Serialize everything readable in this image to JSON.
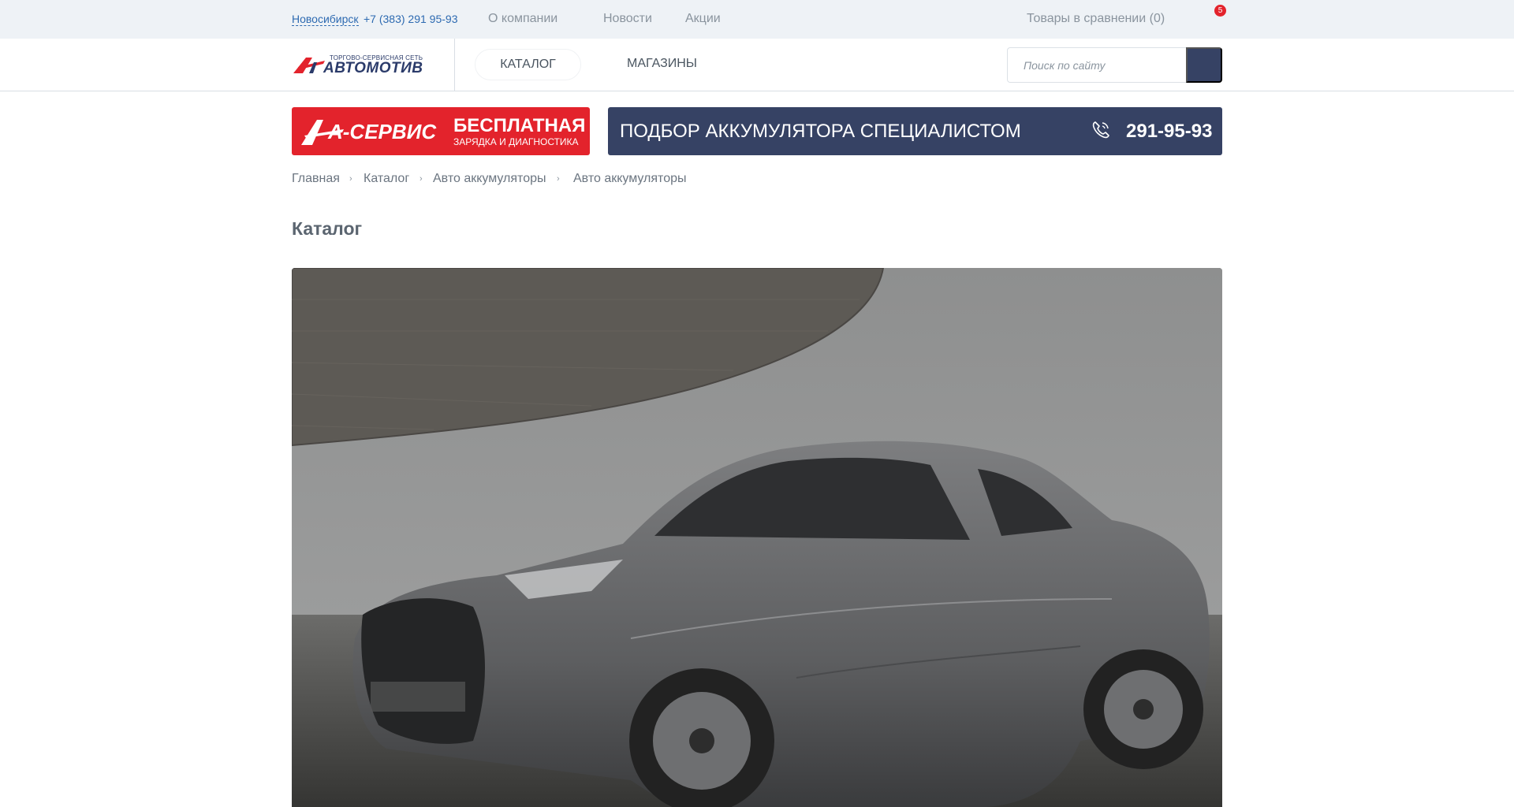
{
  "topbar": {
    "city": "Новосибирск",
    "phone": "+7 (383) 291 95-93",
    "nav": [
      "О компании",
      "Новости",
      "Акции"
    ],
    "compare": "Товары в сравнении (0)",
    "cart_count": "5"
  },
  "header": {
    "logo_tagline": "ТОРГОВО-СЕРВИСНАЯ СЕТЬ",
    "logo_brand": "АВТОМОТИВ",
    "menu_catalog": "КАТАЛОГ",
    "menu_shops": "МАГАЗИНЫ",
    "search_placeholder": "Поиск по сайту"
  },
  "banner_service": {
    "brand": "А-СЕРВИС",
    "headline": "БЕСПЛАТНАЯ",
    "subline": "ЗАРЯДКА И ДИАГНОСТИКА"
  },
  "banner_battery": {
    "title": "ПОДБОР АККУМУЛЯТОРА СПЕЦИАЛИСТОМ",
    "phone": "291-95-93"
  },
  "breadcrumb": [
    "Главная",
    "Каталог",
    "Авто аккумуляторы",
    "Авто аккумуляторы"
  ],
  "page_title": "Каталог",
  "colors": {
    "accent_red": "#e3232c",
    "accent_navy": "#364264",
    "link_blue": "#2d6ab1"
  }
}
